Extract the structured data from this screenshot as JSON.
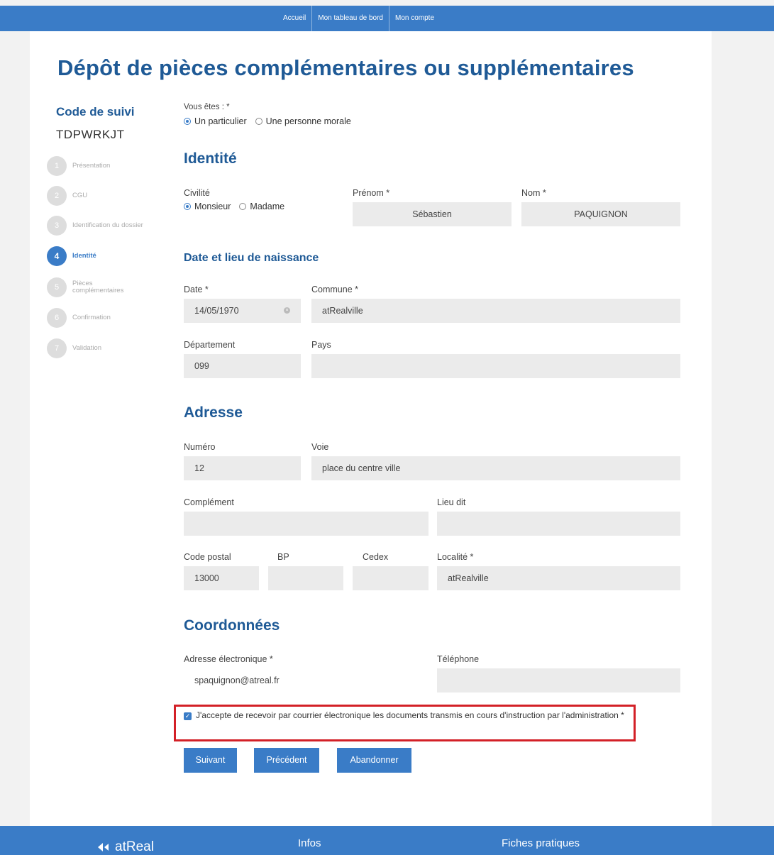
{
  "nav": {
    "items": [
      "Accueil",
      "Mon tableau de bord",
      "Mon compte"
    ]
  },
  "page": {
    "title": "Dépôt de pièces complémentaires ou supplémentaires"
  },
  "tracking": {
    "label": "Code de suivi",
    "code": "TDPWRKJT"
  },
  "steps": [
    {
      "num": "1",
      "label": "Présentation"
    },
    {
      "num": "2",
      "label": "CGU"
    },
    {
      "num": "3",
      "label": "Identification du dossier"
    },
    {
      "num": "4",
      "label": "Identité"
    },
    {
      "num": "5",
      "label": "Pièces complémentaires"
    },
    {
      "num": "6",
      "label": "Confirmation"
    },
    {
      "num": "7",
      "label": "Validation"
    }
  ],
  "active_step": 4,
  "person_type": {
    "label": "Vous êtes : *",
    "options": [
      "Un particulier",
      "Une personne morale"
    ],
    "selected": "Un particulier"
  },
  "identity": {
    "title": "Identité",
    "civility_label": "Civilité",
    "civility_options": [
      "Monsieur",
      "Madame"
    ],
    "civility_selected": "Monsieur",
    "firstname_label": "Prénom *",
    "firstname_value": "Sébastien",
    "lastname_label": "Nom *",
    "lastname_value": "PAQUIGNON"
  },
  "birth": {
    "title": "Date et lieu de naissance",
    "date_label": "Date *",
    "date_value": "14/05/1970",
    "commune_label": "Commune *",
    "commune_value": "atRealville",
    "departement_label": "Département",
    "departement_value": "099",
    "pays_label": "Pays",
    "pays_value": ""
  },
  "address": {
    "title": "Adresse",
    "numero_label": "Numéro",
    "numero_value": "12",
    "voie_label": "Voie",
    "voie_value": "place du centre ville",
    "complement_label": "Complément",
    "complement_value": "",
    "lieudit_label": "Lieu dit",
    "lieudit_value": "",
    "cp_label": "Code postal",
    "cp_value": "13000",
    "bp_label": "BP",
    "bp_value": "",
    "cedex_label": "Cedex",
    "cedex_value": "",
    "localite_label": "Localité *",
    "localite_value": "atRealville"
  },
  "contact": {
    "title": "Coordonnées",
    "email_label": "Adresse électronique *",
    "email_value": "spaquignon@atreal.fr",
    "phone_label": "Téléphone",
    "phone_value": ""
  },
  "consent": {
    "checked": true,
    "text": "J'accepte de recevoir par courrier électronique les documents transmis en cours d'instruction par l'administration *"
  },
  "buttons": {
    "next": "Suivant",
    "previous": "Précédent",
    "abandon": "Abandonner"
  },
  "footer": {
    "logo": "atReal",
    "infos": "Infos",
    "fiches": "Fiches pratiques"
  },
  "colors": {
    "primary": "#3a7cc7",
    "heading": "#1f5a96",
    "highlight": "#d32027",
    "field_bg": "#ebebeb"
  }
}
